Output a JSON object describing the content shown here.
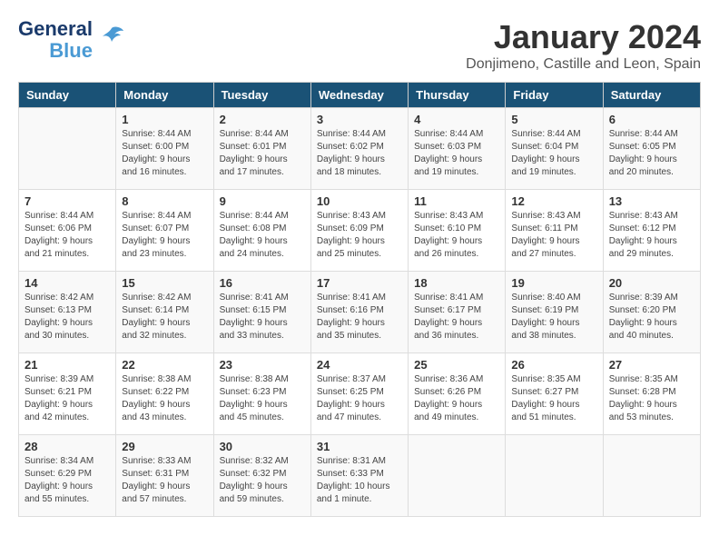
{
  "header": {
    "logo_line1": "General",
    "logo_line2": "Blue",
    "month_title": "January 2024",
    "location": "Donjimeno, Castille and Leon, Spain"
  },
  "days_of_week": [
    "Sunday",
    "Monday",
    "Tuesday",
    "Wednesday",
    "Thursday",
    "Friday",
    "Saturday"
  ],
  "weeks": [
    [
      {
        "day": "",
        "content": ""
      },
      {
        "day": "1",
        "content": "Sunrise: 8:44 AM\nSunset: 6:00 PM\nDaylight: 9 hours\nand 16 minutes."
      },
      {
        "day": "2",
        "content": "Sunrise: 8:44 AM\nSunset: 6:01 PM\nDaylight: 9 hours\nand 17 minutes."
      },
      {
        "day": "3",
        "content": "Sunrise: 8:44 AM\nSunset: 6:02 PM\nDaylight: 9 hours\nand 18 minutes."
      },
      {
        "day": "4",
        "content": "Sunrise: 8:44 AM\nSunset: 6:03 PM\nDaylight: 9 hours\nand 19 minutes."
      },
      {
        "day": "5",
        "content": "Sunrise: 8:44 AM\nSunset: 6:04 PM\nDaylight: 9 hours\nand 19 minutes."
      },
      {
        "day": "6",
        "content": "Sunrise: 8:44 AM\nSunset: 6:05 PM\nDaylight: 9 hours\nand 20 minutes."
      }
    ],
    [
      {
        "day": "7",
        "content": "Sunrise: 8:44 AM\nSunset: 6:06 PM\nDaylight: 9 hours\nand 21 minutes."
      },
      {
        "day": "8",
        "content": "Sunrise: 8:44 AM\nSunset: 6:07 PM\nDaylight: 9 hours\nand 23 minutes."
      },
      {
        "day": "9",
        "content": "Sunrise: 8:44 AM\nSunset: 6:08 PM\nDaylight: 9 hours\nand 24 minutes."
      },
      {
        "day": "10",
        "content": "Sunrise: 8:43 AM\nSunset: 6:09 PM\nDaylight: 9 hours\nand 25 minutes."
      },
      {
        "day": "11",
        "content": "Sunrise: 8:43 AM\nSunset: 6:10 PM\nDaylight: 9 hours\nand 26 minutes."
      },
      {
        "day": "12",
        "content": "Sunrise: 8:43 AM\nSunset: 6:11 PM\nDaylight: 9 hours\nand 27 minutes."
      },
      {
        "day": "13",
        "content": "Sunrise: 8:43 AM\nSunset: 6:12 PM\nDaylight: 9 hours\nand 29 minutes."
      }
    ],
    [
      {
        "day": "14",
        "content": "Sunrise: 8:42 AM\nSunset: 6:13 PM\nDaylight: 9 hours\nand 30 minutes."
      },
      {
        "day": "15",
        "content": "Sunrise: 8:42 AM\nSunset: 6:14 PM\nDaylight: 9 hours\nand 32 minutes."
      },
      {
        "day": "16",
        "content": "Sunrise: 8:41 AM\nSunset: 6:15 PM\nDaylight: 9 hours\nand 33 minutes."
      },
      {
        "day": "17",
        "content": "Sunrise: 8:41 AM\nSunset: 6:16 PM\nDaylight: 9 hours\nand 35 minutes."
      },
      {
        "day": "18",
        "content": "Sunrise: 8:41 AM\nSunset: 6:17 PM\nDaylight: 9 hours\nand 36 minutes."
      },
      {
        "day": "19",
        "content": "Sunrise: 8:40 AM\nSunset: 6:19 PM\nDaylight: 9 hours\nand 38 minutes."
      },
      {
        "day": "20",
        "content": "Sunrise: 8:39 AM\nSunset: 6:20 PM\nDaylight: 9 hours\nand 40 minutes."
      }
    ],
    [
      {
        "day": "21",
        "content": "Sunrise: 8:39 AM\nSunset: 6:21 PM\nDaylight: 9 hours\nand 42 minutes."
      },
      {
        "day": "22",
        "content": "Sunrise: 8:38 AM\nSunset: 6:22 PM\nDaylight: 9 hours\nand 43 minutes."
      },
      {
        "day": "23",
        "content": "Sunrise: 8:38 AM\nSunset: 6:23 PM\nDaylight: 9 hours\nand 45 minutes."
      },
      {
        "day": "24",
        "content": "Sunrise: 8:37 AM\nSunset: 6:25 PM\nDaylight: 9 hours\nand 47 minutes."
      },
      {
        "day": "25",
        "content": "Sunrise: 8:36 AM\nSunset: 6:26 PM\nDaylight: 9 hours\nand 49 minutes."
      },
      {
        "day": "26",
        "content": "Sunrise: 8:35 AM\nSunset: 6:27 PM\nDaylight: 9 hours\nand 51 minutes."
      },
      {
        "day": "27",
        "content": "Sunrise: 8:35 AM\nSunset: 6:28 PM\nDaylight: 9 hours\nand 53 minutes."
      }
    ],
    [
      {
        "day": "28",
        "content": "Sunrise: 8:34 AM\nSunset: 6:29 PM\nDaylight: 9 hours\nand 55 minutes."
      },
      {
        "day": "29",
        "content": "Sunrise: 8:33 AM\nSunset: 6:31 PM\nDaylight: 9 hours\nand 57 minutes."
      },
      {
        "day": "30",
        "content": "Sunrise: 8:32 AM\nSunset: 6:32 PM\nDaylight: 9 hours\nand 59 minutes."
      },
      {
        "day": "31",
        "content": "Sunrise: 8:31 AM\nSunset: 6:33 PM\nDaylight: 10 hours\nand 1 minute."
      },
      {
        "day": "",
        "content": ""
      },
      {
        "day": "",
        "content": ""
      },
      {
        "day": "",
        "content": ""
      }
    ]
  ]
}
